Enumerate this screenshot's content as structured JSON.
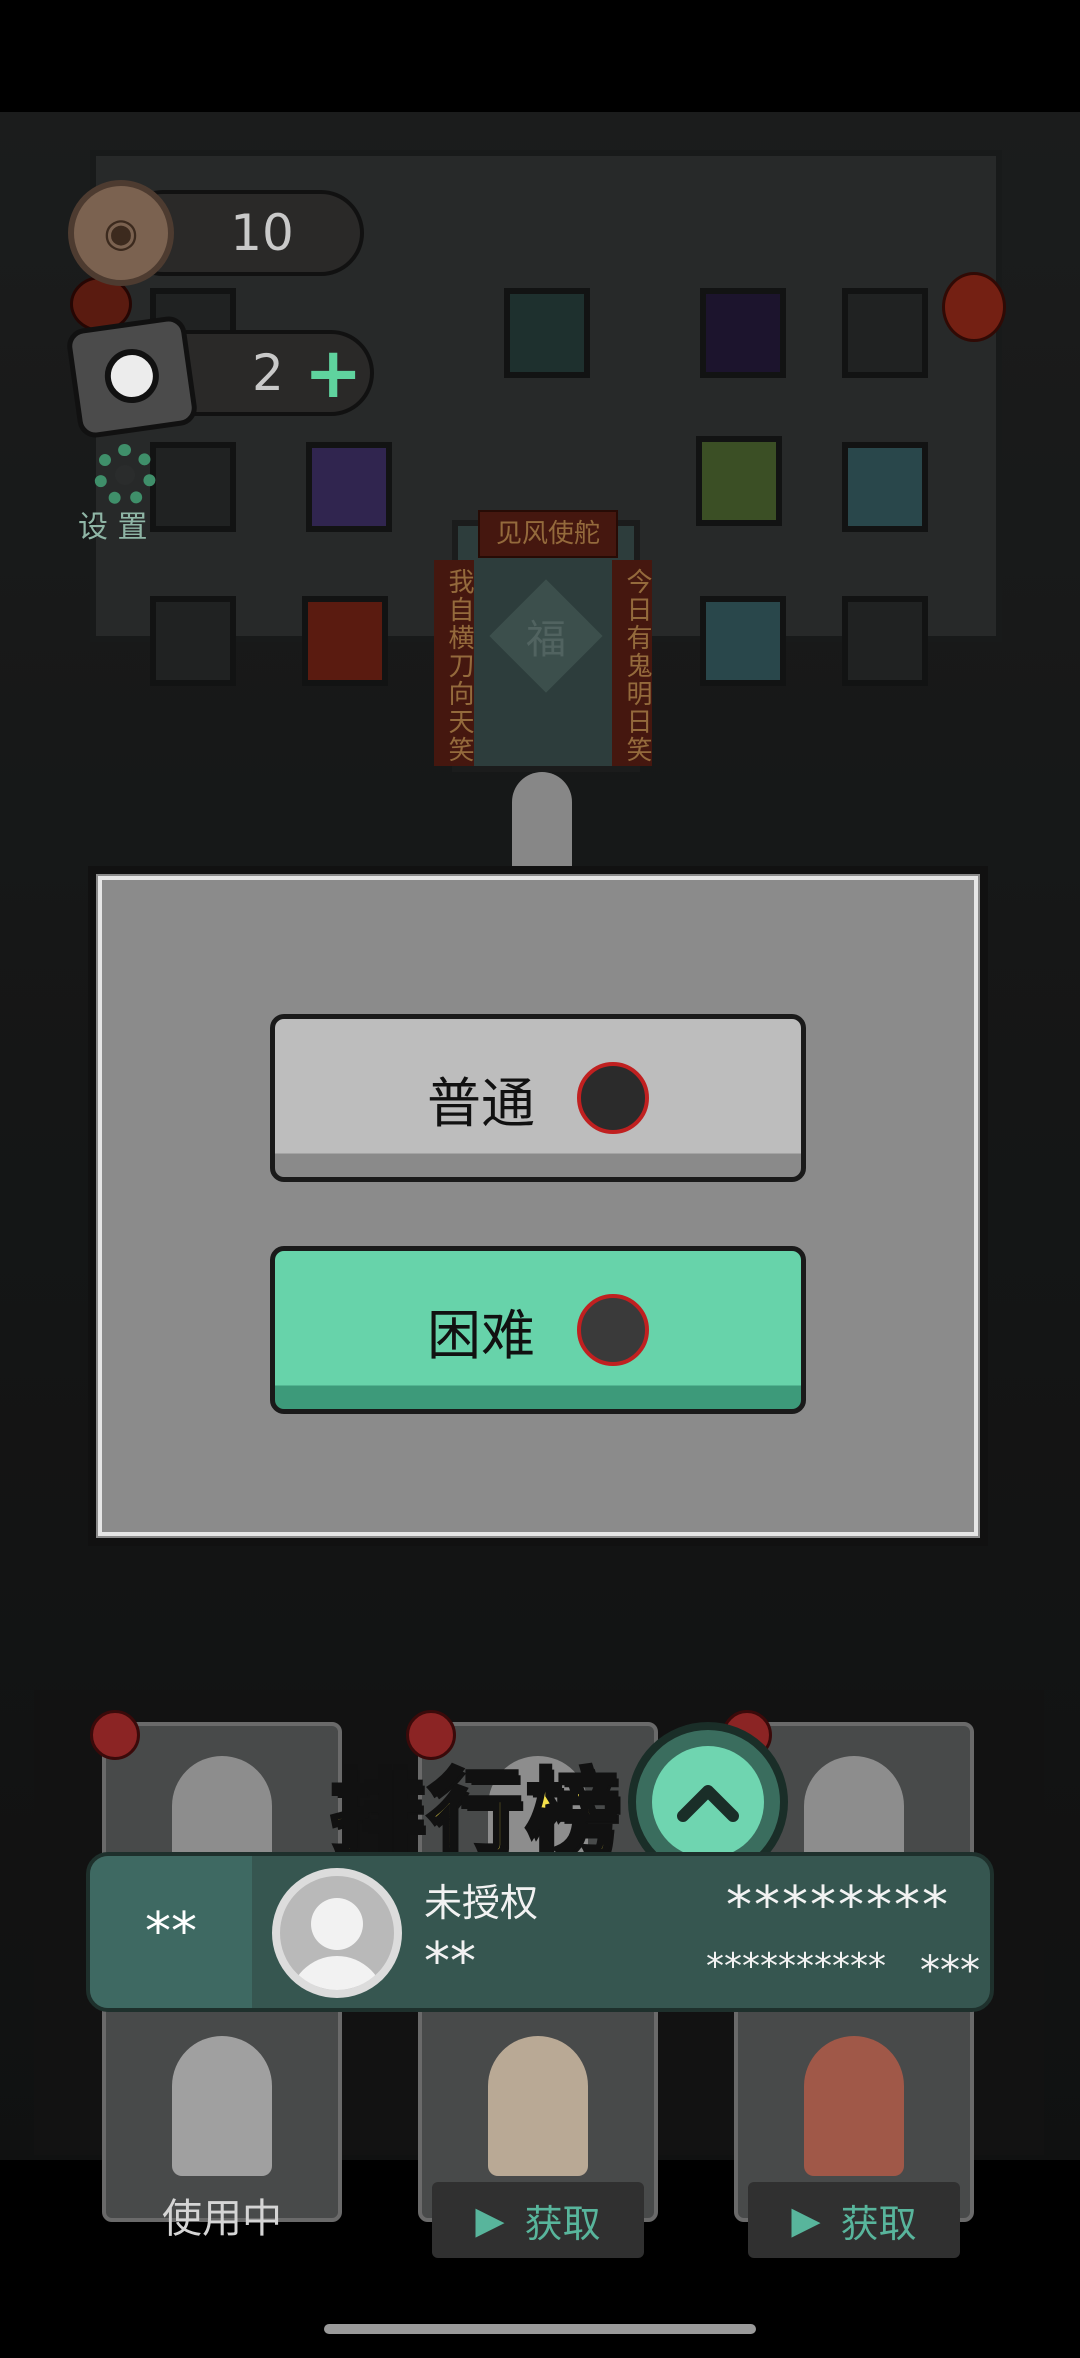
{
  "hud": {
    "coins": "10",
    "tickets": "2",
    "add_label": "+",
    "settings_label": "设 置"
  },
  "scene": {
    "plaque": "见风使舵",
    "couplet_left": "我自横刀向天笑",
    "couplet_right": "今日有鬼明日笑",
    "door_char": "福"
  },
  "difficulty": {
    "normal_label": "普通",
    "hard_label": "困难"
  },
  "leaderboard": {
    "title": "排行榜",
    "rank": "**",
    "name": "未授权",
    "sub_name": "**",
    "score": "********",
    "detail_left": "**********",
    "detail_right": "***"
  },
  "characters": {
    "in_use_label": "使用中",
    "get_label": "获取"
  },
  "colors": {
    "accent_green": "#67d3aa",
    "title_yellow": "#f4e04a"
  }
}
